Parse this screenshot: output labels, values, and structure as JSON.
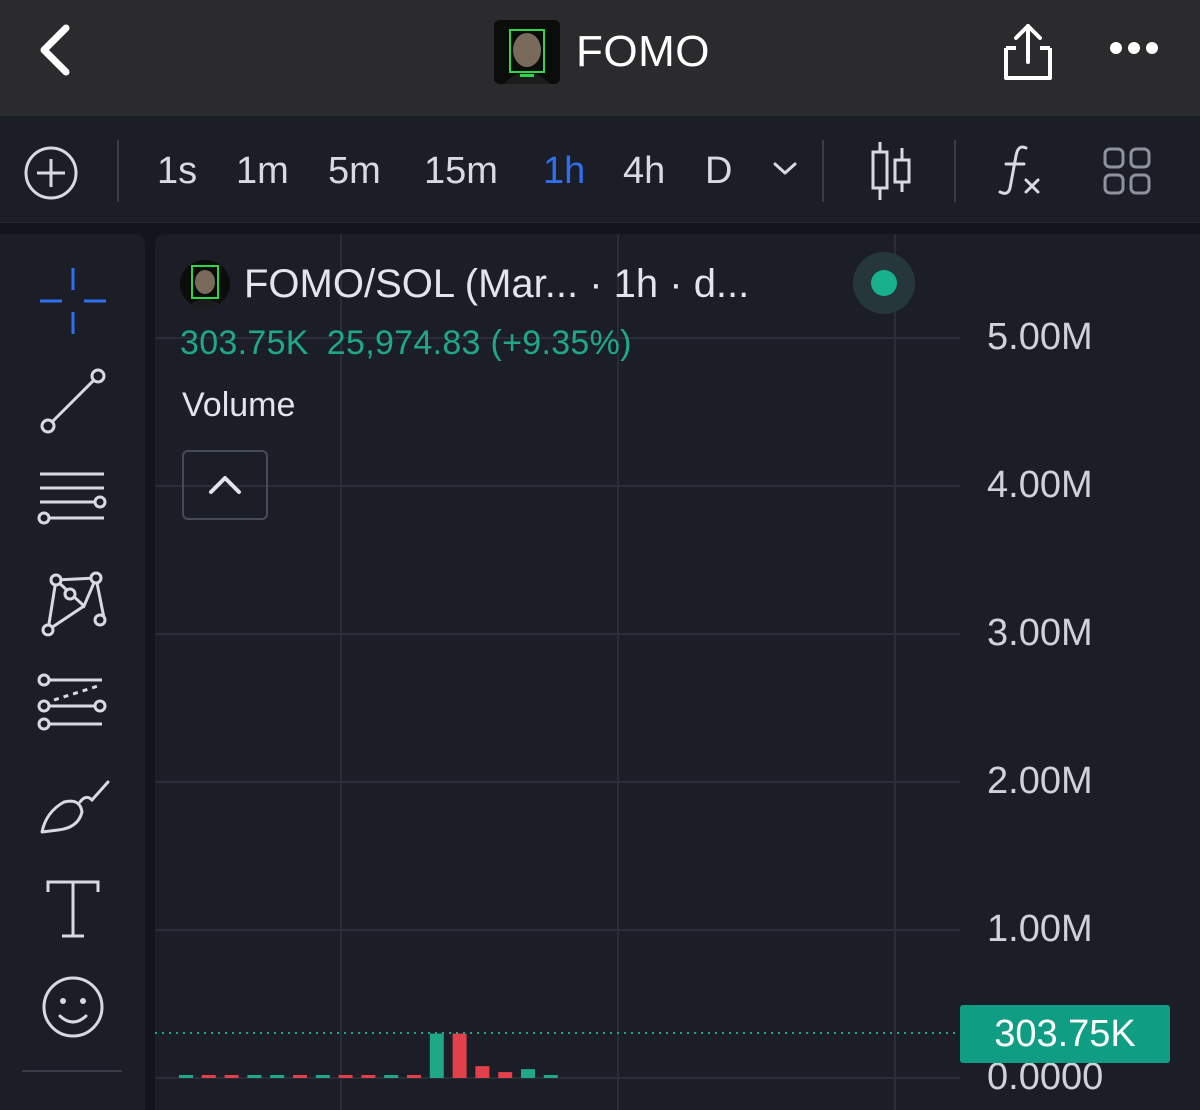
{
  "nav": {
    "title": "FOMO"
  },
  "toolbar": {
    "intervals": [
      "1s",
      "1m",
      "5m",
      "15m",
      "1h",
      "4h",
      "D"
    ],
    "active_interval": "1h"
  },
  "chart_header": {
    "symbol": "FOMO/SOL (Mar... · 1h · d...",
    "last_value": "303.75K",
    "change_text": "25,974.83 (+9.35%)",
    "indicator_label": "Volume"
  },
  "colors": {
    "accent_blue": "#2f6ff0",
    "up_green": "#1fa887",
    "down_red": "#e2414b",
    "live_dot": "#19b08e"
  },
  "icons": [
    "back-chevron-icon",
    "share-icon",
    "more-icon",
    "add-circle-icon",
    "candlestick-icon",
    "function-icon",
    "layout-grid-icon",
    "crosshair-icon",
    "trend-line-icon",
    "horizontal-lines-icon",
    "pattern-icon",
    "forecast-icon",
    "brush-icon",
    "text-icon",
    "emoji-icon",
    "chevron-up-icon"
  ],
  "chart_data": {
    "type": "bar",
    "title": "Volume",
    "yticks": [
      "5.00M",
      "4.00M",
      "3.00M",
      "2.00M",
      "1.00M",
      "0.0000"
    ],
    "ylim": [
      0,
      5000000
    ],
    "last_value_label": "303.75K",
    "last_value": 303750,
    "bars": [
      {
        "color": "up",
        "volume": 6000
      },
      {
        "color": "down",
        "volume": 5000
      },
      {
        "color": "down",
        "volume": 4000
      },
      {
        "color": "up",
        "volume": 4000
      },
      {
        "color": "up",
        "volume": 6000
      },
      {
        "color": "down",
        "volume": 6000
      },
      {
        "color": "up",
        "volume": 5000
      },
      {
        "color": "down",
        "volume": 3000
      },
      {
        "color": "down",
        "volume": 2000
      },
      {
        "color": "up",
        "volume": 2000
      },
      {
        "color": "down",
        "volume": 1000
      },
      {
        "color": "up",
        "volume": 300000
      },
      {
        "color": "down",
        "volume": 300000
      },
      {
        "color": "down",
        "volume": 80000
      },
      {
        "color": "down",
        "volume": 40000
      },
      {
        "color": "up",
        "volume": 60000
      },
      {
        "color": "up",
        "volume": 15000
      }
    ]
  }
}
